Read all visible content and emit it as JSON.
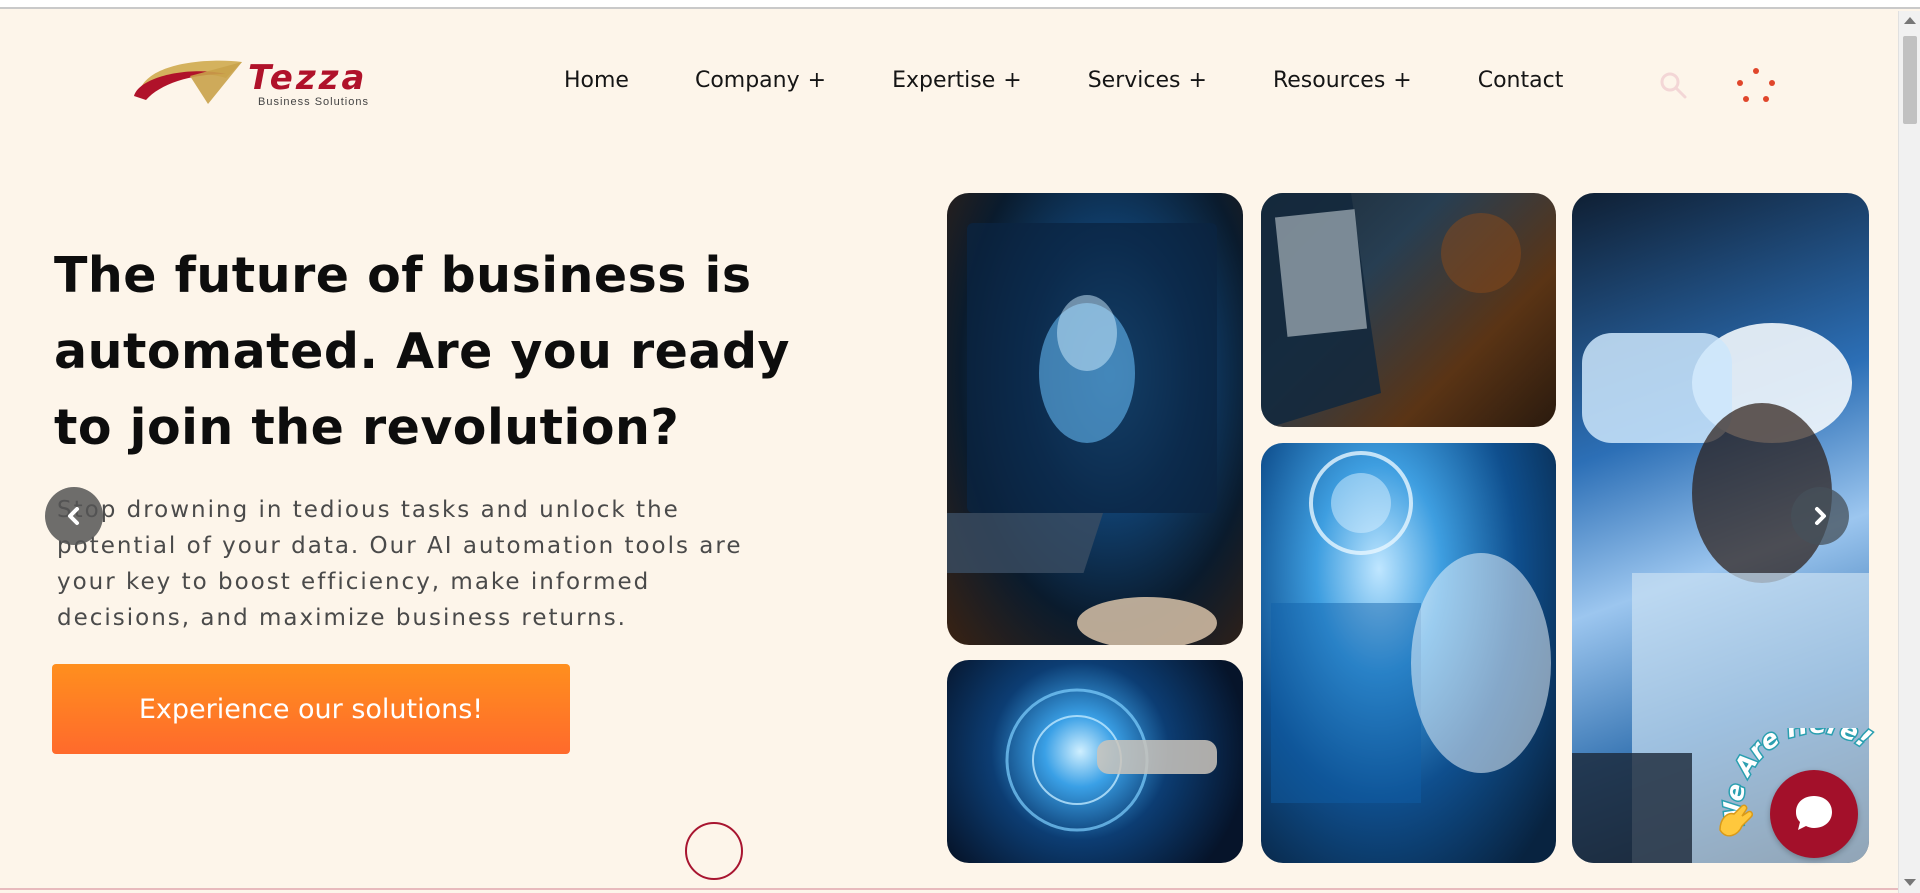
{
  "brand": {
    "logo_word": "Tezza",
    "logo_sub": "Business Solutions"
  },
  "nav": {
    "items": [
      {
        "label": "Home",
        "has_submenu": false
      },
      {
        "label": "Company",
        "has_submenu": true
      },
      {
        "label": "Expertise",
        "has_submenu": true
      },
      {
        "label": "Services",
        "has_submenu": true
      },
      {
        "label": "Resources",
        "has_submenu": true
      },
      {
        "label": "Contact",
        "has_submenu": false
      }
    ],
    "submenu_symbol": "+"
  },
  "hero": {
    "title": "The future of business is automated. Are you ready to join the revolution?",
    "description": "Stop drowning in tedious tasks and unlock the potential of your data. Our AI automation tools are your key to boost efficiency, make informed decisions, and maximize business returns.",
    "cta_label": "Experience our solutions!"
  },
  "icons": {
    "search": "search-icon",
    "menu": "dots-menu-icon",
    "prev": "chevron-left-icon",
    "next": "chevron-right-icon",
    "chat": "chat-bubble-icon",
    "wave": "waving-hand-icon"
  },
  "chat_widget": {
    "label": "We Are Here!"
  },
  "colors": {
    "background": "#fdf5ea",
    "brand_red": "#a3102a",
    "cta_orange": "#ff7a26",
    "logo_gold": "#c9a24a"
  }
}
